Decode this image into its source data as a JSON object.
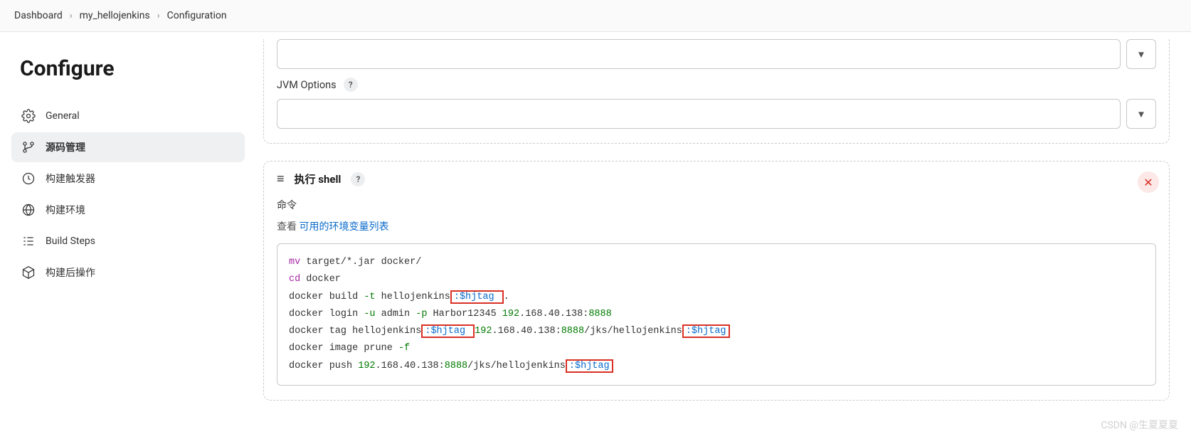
{
  "breadcrumb": {
    "items": [
      "Dashboard",
      "my_hellojenkins",
      "Configuration"
    ]
  },
  "page_title": "Configure",
  "sidebar": {
    "items": [
      {
        "icon": "gear",
        "label": "General"
      },
      {
        "icon": "branch",
        "label": "源码管理"
      },
      {
        "icon": "clock",
        "label": "构建触发器"
      },
      {
        "icon": "globe",
        "label": "构建环境"
      },
      {
        "icon": "steps",
        "label": "Build Steps"
      },
      {
        "icon": "cube",
        "label": "构建后操作"
      }
    ],
    "active_index": 1
  },
  "block1": {
    "field2_label": "JVM Options"
  },
  "shell_block": {
    "title": "执行 shell",
    "command_label": "命令",
    "see_prefix": "查看 ",
    "see_link": "可用的环境变量列表",
    "code": {
      "l1_cmd": "mv",
      "l1_rest": " target/*.jar docker/",
      "l2_cmd": "cd",
      "l2_rest": " docker",
      "l3_p1": "docker build ",
      "l3_flag": "-t",
      "l3_p2": " hellojenkins",
      "l3_hl": ":$hjtag ",
      "l3_p3": ".",
      "l4_p1": "docker login ",
      "l4_flag1": "-u",
      "l4_p2": " admin ",
      "l4_flag2": "-p",
      "l4_p3": " Harbor12345 ",
      "l4_num1": "192",
      "l4_p4": ".168.40.138:",
      "l4_num2": "8888",
      "l5_p1": "docker tag hellojenkins",
      "l5_hl1": ":$hjtag ",
      "l5_num1": "192",
      "l5_p2": ".168.40.138:",
      "l5_num2": "8888",
      "l5_p3": "/jks/hellojenkins",
      "l5_hl2": ":$hjtag",
      "l6_p1": "docker image prune ",
      "l6_flag": "-f",
      "l7_p1": "docker push ",
      "l7_num1": "192",
      "l7_p2": ".168.40.138:",
      "l7_num2": "8888",
      "l7_p3": "/jks/hellojenkins",
      "l7_hl": ":$hjtag"
    }
  },
  "watermark": "CSDN @生夏夏夏"
}
